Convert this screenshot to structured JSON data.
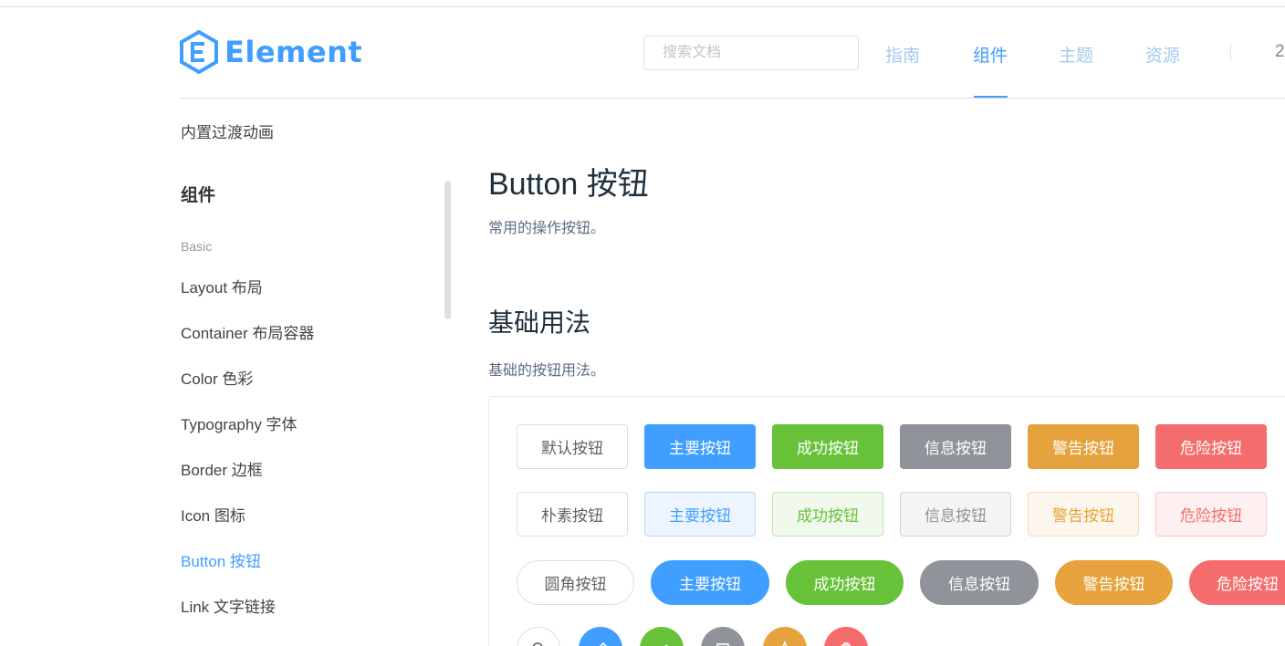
{
  "header": {
    "logo_text": "Element",
    "search_placeholder": "搜索文档",
    "nav": [
      "指南",
      "组件",
      "主题",
      "资源"
    ],
    "nav_extra": "2"
  },
  "sidebar": {
    "top_link": "内置过渡动画",
    "group_title": "组件",
    "subgroup": "Basic",
    "items": [
      "Layout 布局",
      "Container 布局容器",
      "Color 色彩",
      "Typography 字体",
      "Border 边框",
      "Icon 图标",
      "Button 按钮",
      "Link 文字链接"
    ]
  },
  "main": {
    "title": "Button 按钮",
    "description": "常用的操作按钮。",
    "section_title": "基础用法",
    "section_description": "基础的按钮用法。",
    "row1": [
      "默认按钮",
      "主要按钮",
      "成功按钮",
      "信息按钮",
      "警告按钮",
      "危险按钮"
    ],
    "row2": [
      "朴素按钮",
      "主要按钮",
      "成功按钮",
      "信息按钮",
      "警告按钮",
      "危险按钮"
    ],
    "row3": [
      "圆角按钮",
      "主要按钮",
      "成功按钮",
      "信息按钮",
      "警告按钮",
      "危险按钮"
    ],
    "row4_icons": [
      "search-icon",
      "edit-icon",
      "check-icon",
      "message-icon",
      "star-icon",
      "delete-icon"
    ]
  },
  "colors": {
    "primary": "#409eff",
    "success": "#67c23a",
    "info": "#909399",
    "warning": "#e6a23c",
    "danger": "#f56c6c"
  }
}
